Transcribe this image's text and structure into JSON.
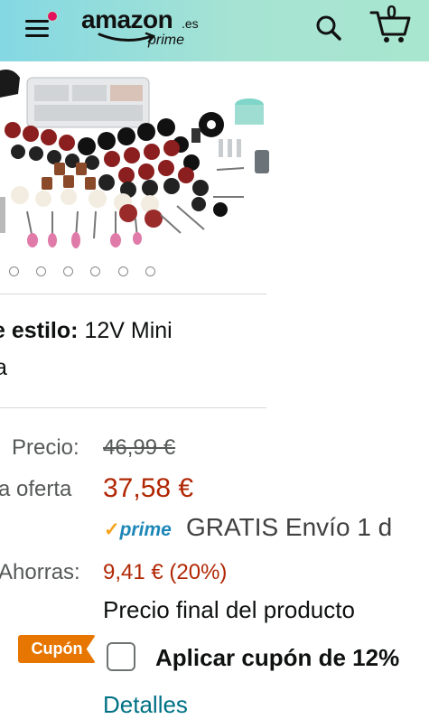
{
  "header": {
    "logo_word": "amazon",
    "logo_tld": ".es",
    "logo_sub": "prime",
    "cart_count": "0",
    "colors": {
      "header_gradient_start": "#84d8e3",
      "header_gradient_end": "#a9e6cf",
      "menu_badge": "#e3125a"
    },
    "icons": [
      "hamburger-menu-icon",
      "search-icon",
      "cart-icon"
    ]
  },
  "gallery": {
    "dot_count": 6
  },
  "style": {
    "label": "e estilo:",
    "value": "12V Mini",
    "value_cont": "a"
  },
  "pricing": {
    "list_label": "Precio:",
    "list_price": "46,99 €",
    "deal_label": "a oferta",
    "deal_price": "37,58 €",
    "prime_label": "prime",
    "shipping": "GRATIS Envío 1 d",
    "savings_label": "Ahorras:",
    "savings_value": "9,41 € (20%)",
    "final_note": "Precio final del producto"
  },
  "coupon": {
    "tag": "Cupón",
    "text": "Aplicar cupón de 12%",
    "details": "Detalles",
    "colors": {
      "tag": "#e77600",
      "price": "#b12704",
      "link": "#007185"
    }
  }
}
